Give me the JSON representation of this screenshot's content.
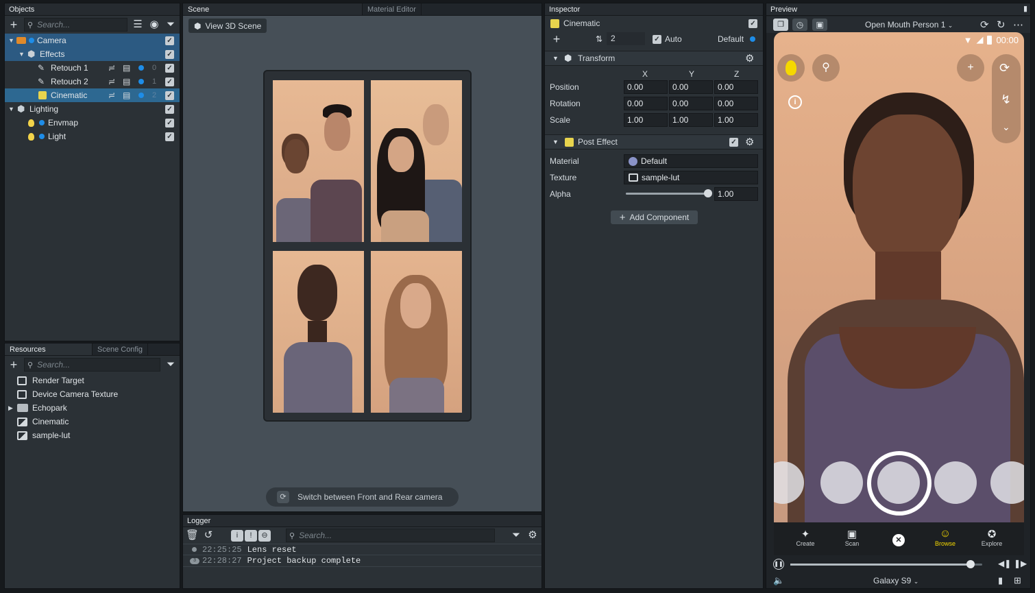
{
  "objects": {
    "title": "Objects",
    "search_placeholder": "Search...",
    "rows": [
      {
        "label": "Camera"
      },
      {
        "label": "Effects"
      },
      {
        "label": "Retouch 1",
        "layer": "0"
      },
      {
        "label": "Retouch 2",
        "layer": "1"
      },
      {
        "label": "Cinematic",
        "layer": "2"
      },
      {
        "label": "Lighting"
      },
      {
        "label": "Envmap"
      },
      {
        "label": "Light"
      }
    ]
  },
  "resources": {
    "tab_active": "Resources",
    "tab_inactive": "Scene Config",
    "search_placeholder": "Search...",
    "items": [
      {
        "label": "Render Target"
      },
      {
        "label": "Device Camera Texture"
      },
      {
        "label": "Echopark"
      },
      {
        "label": "Cinematic"
      },
      {
        "label": "sample-lut"
      }
    ]
  },
  "scene": {
    "tab_active": "Scene",
    "tab_inactive": "Material Editor",
    "view_button": "View 3D Scene",
    "switch_label": "Switch between Front and Rear camera"
  },
  "logger": {
    "title": "Logger",
    "search_placeholder": "Search...",
    "entries": [
      {
        "time": "22:25:25",
        "message": "Lens reset"
      },
      {
        "time": "22:28:27",
        "message": "Project backup complete",
        "badge": "3"
      }
    ]
  },
  "inspector": {
    "title": "Inspector",
    "object_name": "Cinematic",
    "layer_value": "2",
    "auto_label": "Auto",
    "default_label": "Default",
    "transform": {
      "title": "Transform",
      "headers": [
        "X",
        "Y",
        "Z"
      ],
      "rows": [
        {
          "label": "Position",
          "values": [
            "0.00",
            "0.00",
            "0.00"
          ]
        },
        {
          "label": "Rotation",
          "values": [
            "0.00",
            "0.00",
            "0.00"
          ]
        },
        {
          "label": "Scale",
          "values": [
            "1.00",
            "1.00",
            "1.00"
          ]
        }
      ]
    },
    "post_effect": {
      "title": "Post Effect",
      "material_label": "Material",
      "material_value": "Default",
      "texture_label": "Texture",
      "texture_value": "sample-lut",
      "alpha_label": "Alpha",
      "alpha_value": "1.00",
      "alpha_fraction": 1.0
    },
    "add_component": "Add Component"
  },
  "preview": {
    "title": "Preview",
    "person_select": "Open Mouth Person 1",
    "status_time": "00:00",
    "nav": [
      {
        "label": "Create"
      },
      {
        "label": "Scan"
      },
      {
        "label": ""
      },
      {
        "label": "Browse"
      },
      {
        "label": "Explore"
      }
    ],
    "device": "Galaxy S9",
    "scrub_fraction": 0.94
  },
  "colors": {
    "accent": "#1e8de8",
    "selection": "#2c5a82",
    "browse": "#f5d800"
  }
}
